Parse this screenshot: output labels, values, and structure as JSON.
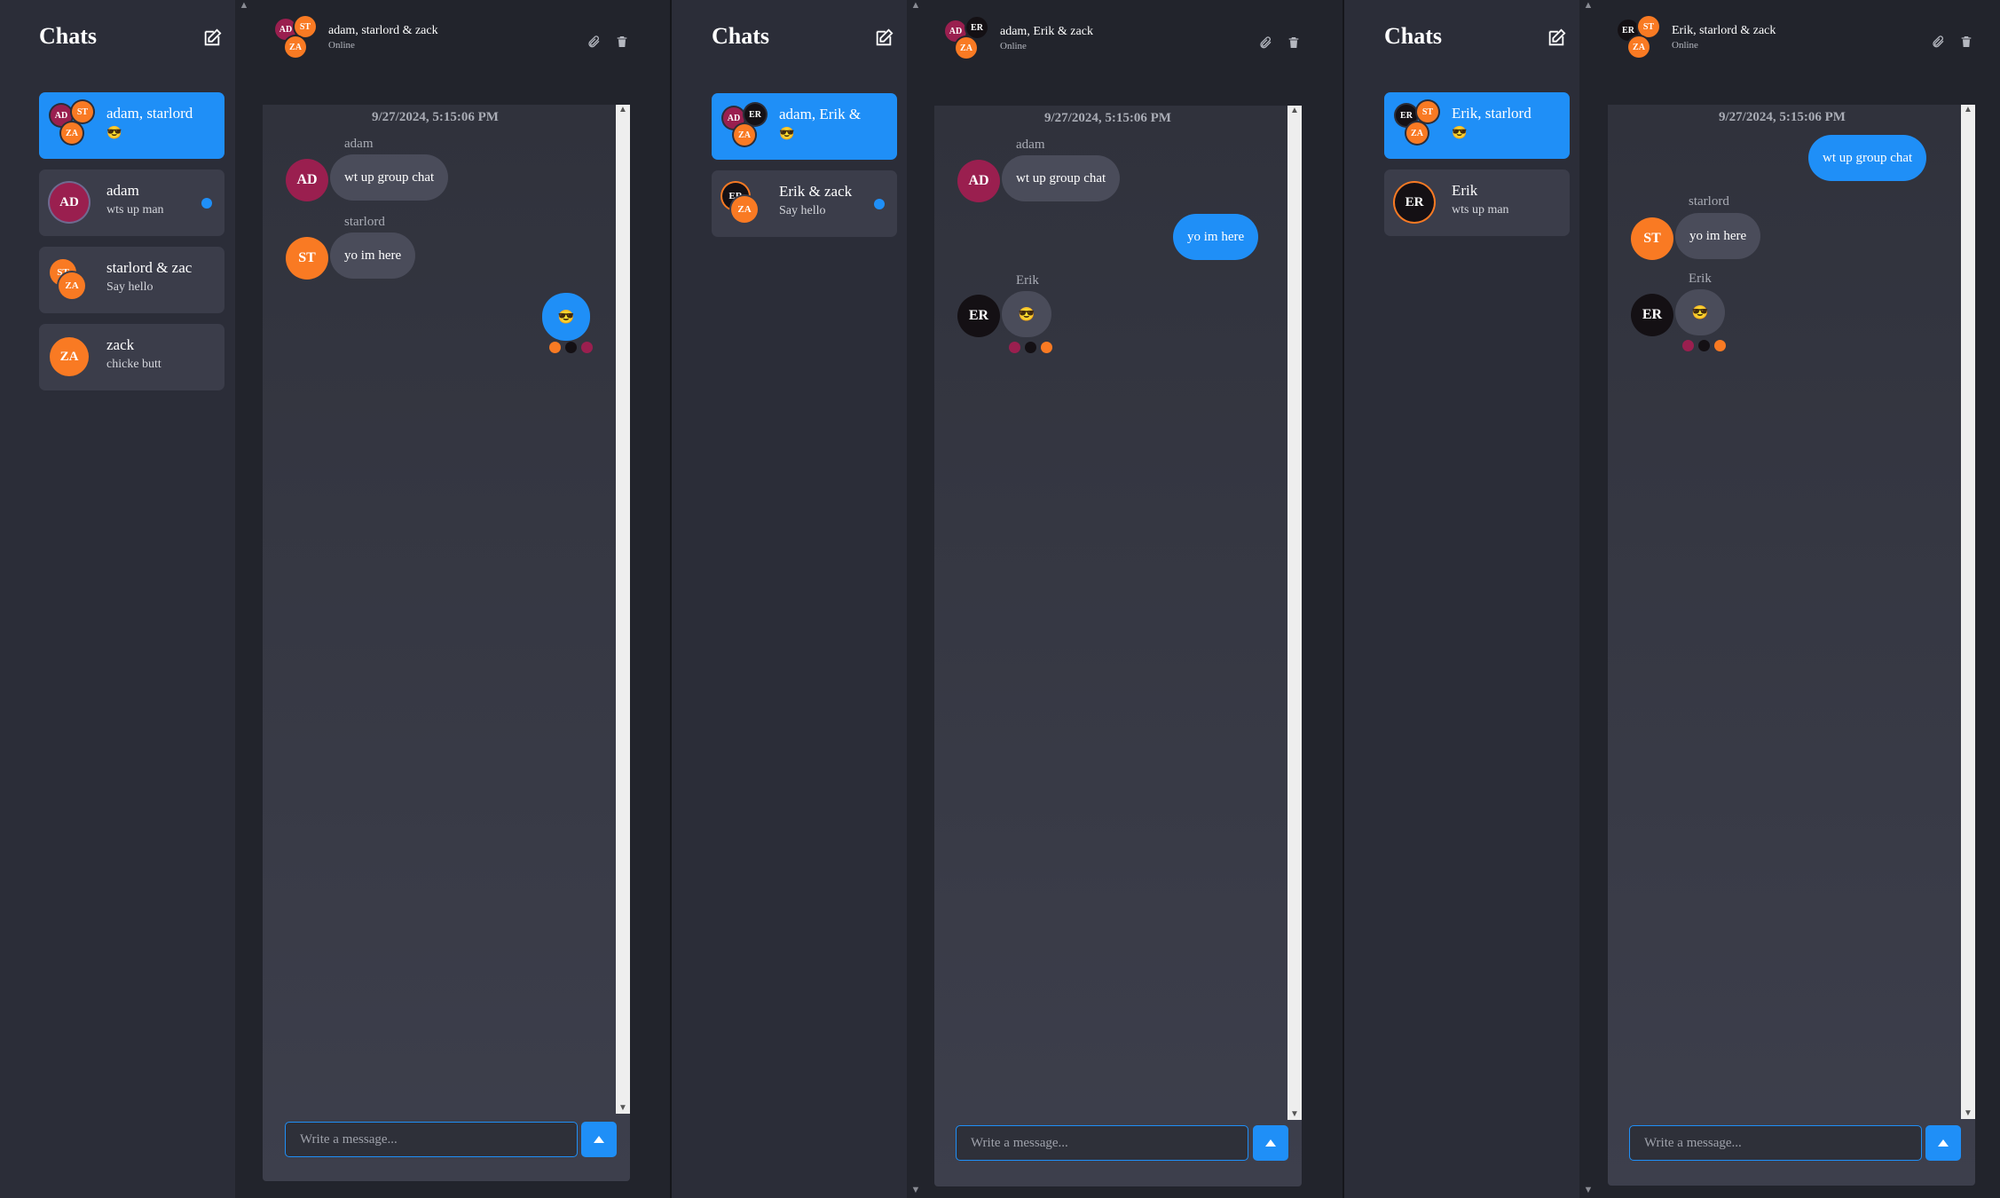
{
  "colors": {
    "accent": "#1f8ff7",
    "adam": "#9a1f4f",
    "starlord": "#f97a23",
    "zack": "#f97a23",
    "erik": "#141014"
  },
  "panes": [
    {
      "sidebar": {
        "title": "Chats",
        "items": [
          {
            "name": "adam, starlord",
            "last": "😎",
            "active": true
          },
          {
            "name": "adam",
            "last": "wts up man",
            "unread": true
          },
          {
            "name": "starlord & zac",
            "last": "Say hello"
          },
          {
            "name": "zack",
            "last": "chicke butt"
          }
        ]
      },
      "chat": {
        "title": "adam, starlord & zack",
        "status": "Online",
        "timestamp": "9/27/2024, 5:15:06 PM",
        "messages": [
          {
            "sender": "adam",
            "text": "wt up group chat",
            "avatar": "AD"
          },
          {
            "sender": "starlord",
            "text": "yo im here",
            "avatar": "ST"
          },
          {
            "sender": "",
            "text": "😎"
          }
        ],
        "placeholder": "Write a message..."
      }
    },
    {
      "sidebar": {
        "title": "Chats",
        "items": [
          {
            "name": "adam, Erik &",
            "last": "😎",
            "active": true
          },
          {
            "name": "Erik & zack",
            "last": "Say hello",
            "unread": true
          }
        ]
      },
      "chat": {
        "title": "adam, Erik & zack",
        "status": "Online",
        "timestamp": "9/27/2024, 5:15:06 PM",
        "messages": [
          {
            "sender": "adam",
            "text": "wt up group chat",
            "avatar": "AD"
          },
          {
            "sender": "",
            "text": "yo im here"
          },
          {
            "sender": "Erik",
            "text": "😎",
            "avatar": "ER"
          }
        ],
        "placeholder": "Write a message..."
      }
    },
    {
      "sidebar": {
        "title": "Chats",
        "items": [
          {
            "name": "Erik, starlord",
            "last": "😎",
            "active": true
          },
          {
            "name": "Erik",
            "last": "wts up man"
          }
        ]
      },
      "chat": {
        "title": "Erik, starlord & zack",
        "status": "Online",
        "timestamp": "9/27/2024, 5:15:06 PM",
        "messages": [
          {
            "sender": "",
            "text": "wt up group chat"
          },
          {
            "sender": "starlord",
            "text": "yo im here",
            "avatar": "ST"
          },
          {
            "sender": "Erik",
            "text": "😎",
            "avatar": "ER"
          }
        ],
        "placeholder": "Write a message..."
      }
    }
  ],
  "initials": {
    "ad": "AD",
    "st": "ST",
    "za": "ZA",
    "er": "ER"
  }
}
